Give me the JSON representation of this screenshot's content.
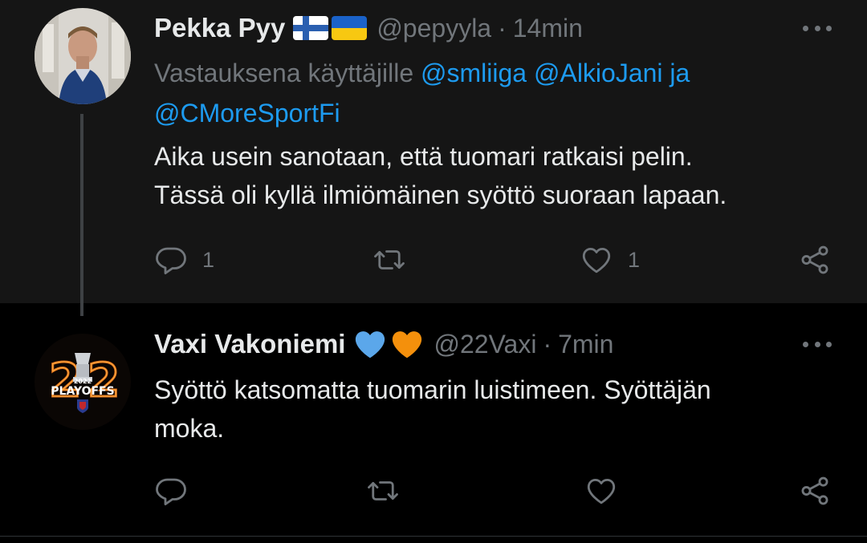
{
  "colors": {
    "background_highlight": "#151515",
    "background": "#000000",
    "text_primary": "#e7e9ea",
    "text_secondary": "#71767b",
    "link": "#1d9bf0",
    "heart_blue": "#5ba7ea",
    "heart_orange": "#f4900c"
  },
  "tweets": [
    {
      "display_name": "Pekka Pyy",
      "name_emojis": [
        "finland-flag-icon",
        "ukraine-flag-icon"
      ],
      "handle": "@pepyyla",
      "separator": "·",
      "time": "14min",
      "reply_prefix": "Vastauksena käyttäjille",
      "reply_mentions": [
        "@smliiga",
        "@AlkioJani"
      ],
      "reply_joiner": "ja",
      "reply_last_mention": "@CMoreSportFi",
      "text_line1": "Aika usein sanotaan, että tuomari ratkaisi pelin.",
      "text_line2": "Tässä oli kyllä ilmiömäinen syöttö suoraan lapaan.",
      "reply_count": "1",
      "retweet_count": "",
      "like_count": "1"
    },
    {
      "display_name": "Vaxi Vakoniemi",
      "name_emojis": [
        "blue-heart-icon",
        "orange-heart-icon"
      ],
      "handle": "@22Vaxi",
      "separator": "·",
      "time": "7min",
      "text_line1": "Syöttö katsomatta tuomarin luistimeen. Syöttäjän",
      "text_line2": "moka.",
      "avatar_text": "PLAYOFFS",
      "avatar_year": "2022",
      "reply_count": "",
      "retweet_count": "",
      "like_count": ""
    }
  ]
}
